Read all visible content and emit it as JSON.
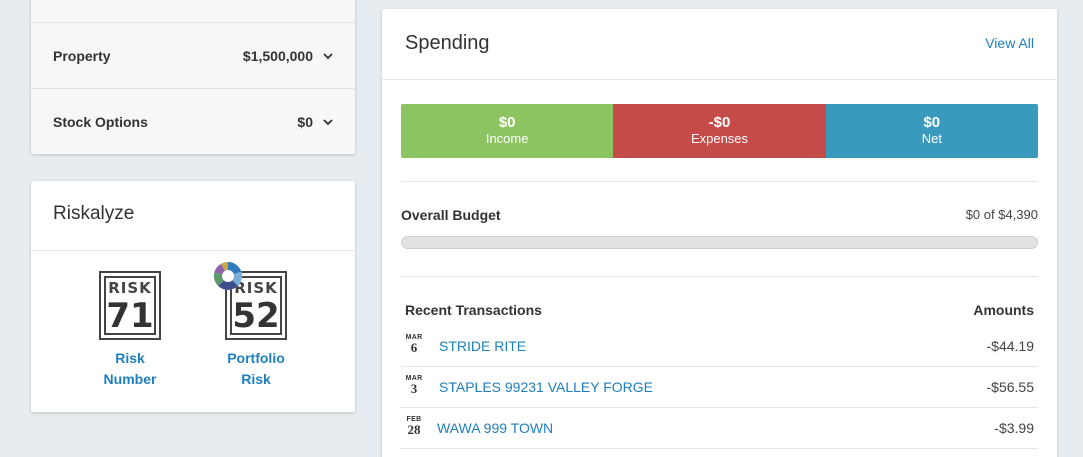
{
  "assets": {
    "rows": [
      {
        "label": "Property",
        "value": "$1,500,000"
      },
      {
        "label": "Stock Options",
        "value": "$0"
      }
    ]
  },
  "riskalyze": {
    "title": "Riskalyze",
    "badges": [
      {
        "word": "RISK",
        "number": "71",
        "label_line1": "Risk",
        "label_line2": "Number"
      },
      {
        "word": "RISK",
        "number": "52",
        "label_line1": "Portfolio",
        "label_line2": "Risk"
      }
    ]
  },
  "spending": {
    "title": "Spending",
    "view_all": "View All",
    "summary": {
      "income": {
        "amount": "$0",
        "label": "Income"
      },
      "expenses": {
        "amount": "-$0",
        "label": "Expenses"
      },
      "net": {
        "amount": "$0",
        "label": "Net"
      }
    },
    "budget": {
      "label": "Overall Budget",
      "value_text": "$0 of $4,390",
      "progress_fraction": 0
    },
    "transactions_header": "Recent Transactions",
    "amounts_header": "Amounts",
    "transactions": [
      {
        "month": "MAR",
        "day": "6",
        "name": "STRIDE RITE",
        "amount": "-$44.19"
      },
      {
        "month": "MAR",
        "day": "3",
        "name": "STAPLES 99231 VALLEY FORGE",
        "amount": "-$56.55"
      },
      {
        "month": "FEB",
        "day": "28",
        "name": "WAWA 999 TOWN",
        "amount": "-$3.99"
      }
    ]
  },
  "colors": {
    "income": "#8dc462",
    "expenses": "#c44b47",
    "net": "#3a9abd",
    "link": "#1e7fbf",
    "page_bg": "#e6ecef"
  },
  "icons": [
    "chevron-down-icon",
    "risk-number-badge-icon",
    "portfolio-risk-badge-icon",
    "portfolio-pie-icon"
  ]
}
